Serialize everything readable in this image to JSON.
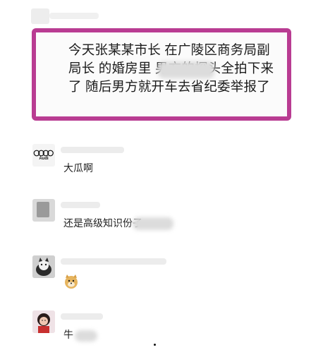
{
  "post": {
    "text": "今天张某某市长 在广陵区商务局副局长 的婚房里                  男方的探头全拍下来了 随后男方就开车去省纪委举报了"
  },
  "comments": [
    {
      "avatar": "audi-logo-avatar",
      "avatar_label": "Audi",
      "text": "大瓜啊"
    },
    {
      "avatar": "gray-photo-avatar",
      "text": "还是高级知识份子"
    },
    {
      "avatar": "cat-photo-avatar",
      "emoji": "doge-emoji-icon",
      "text": ""
    },
    {
      "avatar": "girl-photo-avatar",
      "text": "牛"
    }
  ],
  "colors": {
    "highlight_border": "#b93c92",
    "text": "#1b1b1b"
  }
}
